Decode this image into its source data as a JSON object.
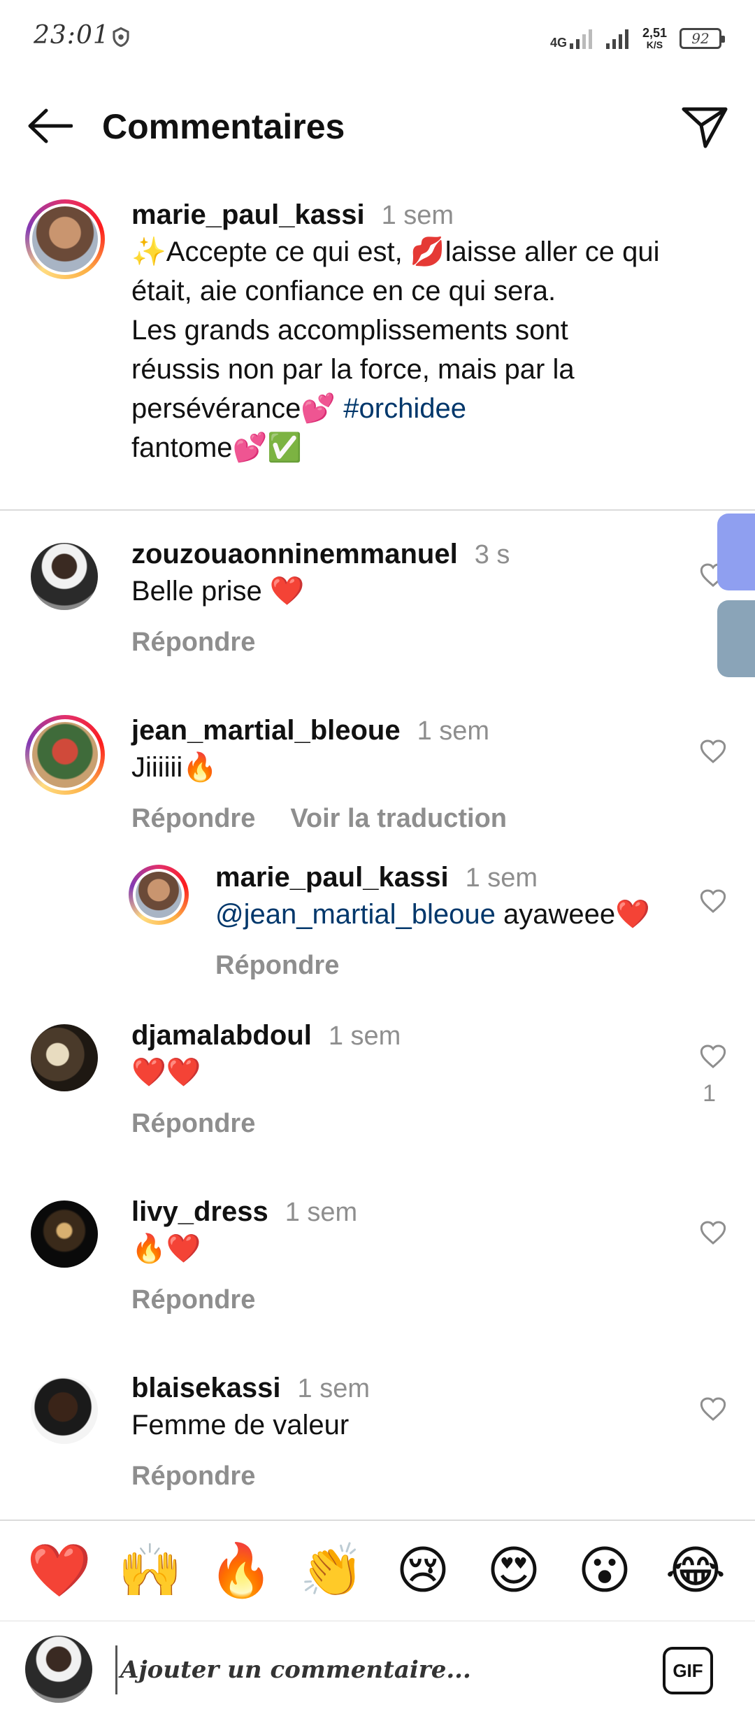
{
  "status_bar": {
    "time": "23:01",
    "network": "4G",
    "speed_value": "2,51",
    "speed_unit": "K/S",
    "battery": "92"
  },
  "header": {
    "title": "Commentaires"
  },
  "caption": {
    "username": "marie_paul_kassi",
    "time": "1 sem",
    "text_parts": {
      "p1": "✨Accepte ce qui est, 💋laisse aller ce qui était, aie confiance en ce qui sera.",
      "p2": " Les grands accomplissements sont réussis non par la force, mais par la persévérance💕",
      "hashtag": "#orchidee",
      "p3": "fantome💕✅"
    }
  },
  "comments": [
    {
      "username": "zouzouaonninemmanuel",
      "time": "3 s",
      "text": "Belle prise ❤️",
      "reply_label": "Répondre"
    },
    {
      "username": "jean_martial_bleoue",
      "time": "1 sem",
      "text": "Jiiiiii🔥",
      "reply_label": "Répondre",
      "translate_label": "Voir la traduction"
    },
    {
      "username": "djamalabdoul",
      "time": "1 sem",
      "text": "❤️❤️",
      "reply_label": "Répondre",
      "likes": "1"
    },
    {
      "username": "livy_dress",
      "time": "1 sem",
      "text": "🔥❤️",
      "reply_label": "Répondre"
    },
    {
      "username": "blaisekassi",
      "time": "1 sem",
      "text": "Femme de valeur",
      "reply_label": "Répondre"
    }
  ],
  "reply": {
    "username": "marie_paul_kassi",
    "time": "1 sem",
    "mention": "@jean_martial_bleoue",
    "text": " ayaweee❤️",
    "reply_label": "Répondre"
  },
  "emoji_bar": [
    "❤️",
    "🙌",
    "🔥",
    "👏",
    "😢",
    "😍",
    "😮",
    "😂"
  ],
  "composer": {
    "placeholder": "Ajouter un commentaire...",
    "gif_label": "GIF"
  },
  "colors": {
    "link": "#00376b",
    "secondary_text": "#8e8e8e",
    "divider": "#dbdbdb"
  }
}
